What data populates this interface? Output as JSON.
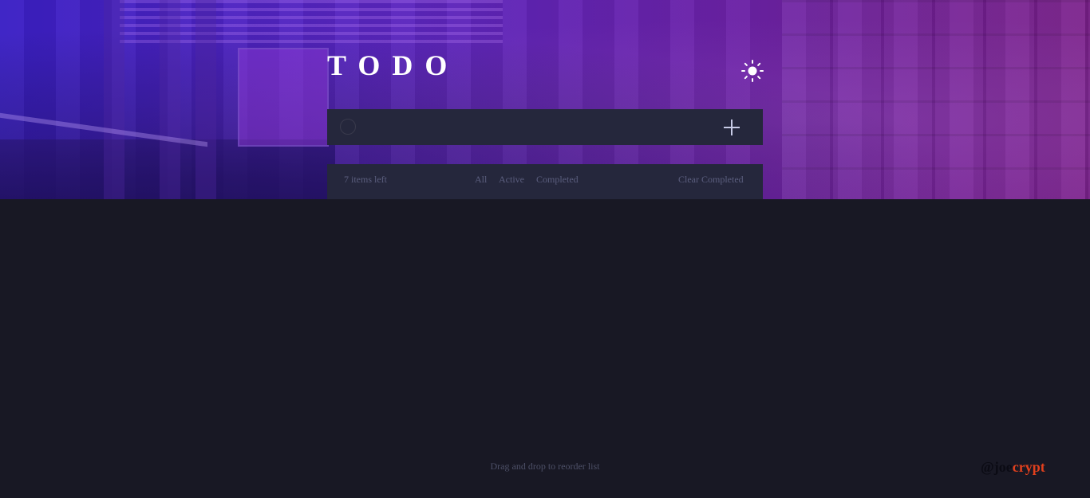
{
  "header": {
    "title": "TODO",
    "theme_toggle_icon": "sun-icon"
  },
  "new_todo": {
    "value": "",
    "placeholder": "",
    "add_icon": "plus-icon"
  },
  "footer": {
    "items_left": "7 items left",
    "filters": [
      "All",
      "Active",
      "Completed"
    ],
    "clear_completed": "Clear Completed"
  },
  "hint": "Drag and drop to reorder list",
  "signature": {
    "part1": "@joe",
    "part2": "crypt"
  },
  "colors": {
    "background": "#181824",
    "panel": "#25273c",
    "muted_text": "#5b5e7e",
    "signature_accent": "#e1401d",
    "gradient_start": "#3a1fc4",
    "gradient_end": "#7a1f8a"
  }
}
